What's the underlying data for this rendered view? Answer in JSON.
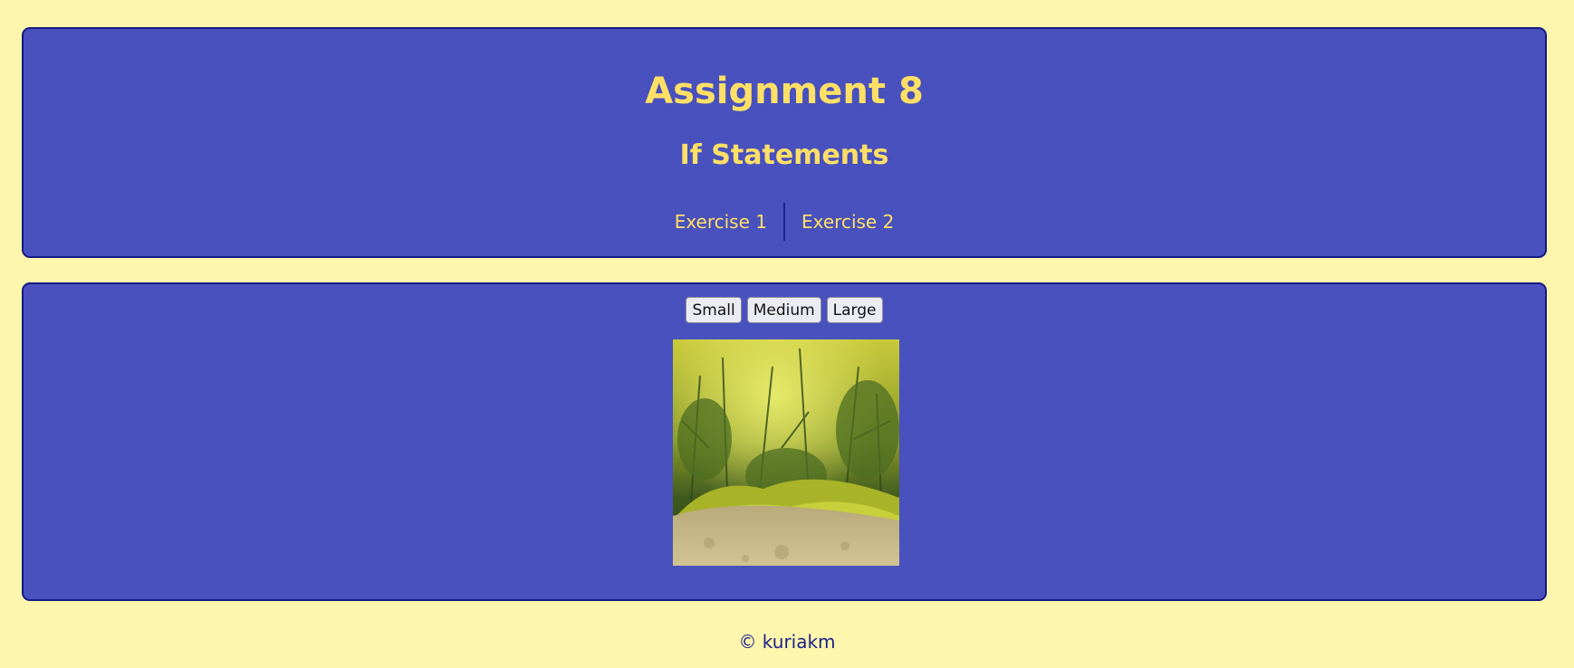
{
  "header": {
    "title": "Assignment 8",
    "subtitle": "If Statements",
    "nav": [
      {
        "label": "Exercise 1"
      },
      {
        "label": "Exercise 2"
      }
    ]
  },
  "main": {
    "buttons": [
      {
        "label": "Small"
      },
      {
        "label": "Medium"
      },
      {
        "label": "Large"
      }
    ]
  },
  "footer": {
    "text": "© kuriakm"
  },
  "colors": {
    "page_bg": "#fff6ad",
    "panel_bg": "#4851bd",
    "panel_border": "#141a86",
    "heading_text": "#ffe066",
    "footer_text": "#1b1f8c"
  }
}
